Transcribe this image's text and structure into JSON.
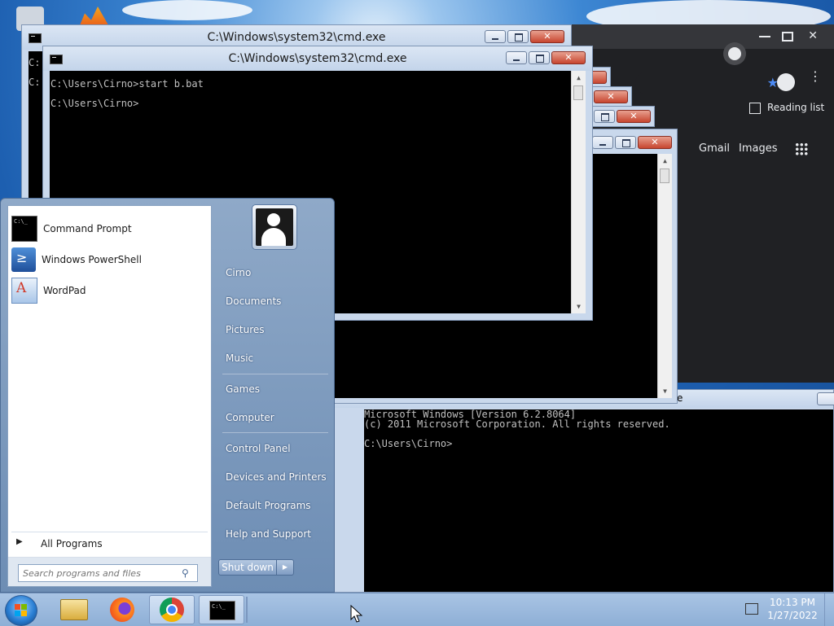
{
  "cmd_back": {
    "title": "C:\\Windows\\system32\\cmd.exe",
    "lines": [
      "C:",
      "C:"
    ]
  },
  "cmd_front": {
    "title": "C:\\Windows\\system32\\cmd.exe",
    "lines": [
      "C:\\Users\\Cirno>start b.bat",
      "C:\\Users\\Cirno>"
    ]
  },
  "cmd_bottom": {
    "lines": [
      "Microsoft Windows [Version 6.2.8064]",
      "(c) 2011 Microsoft Corporation. All rights reserved.",
      "",
      "C:\\Users\\Cirno>"
    ]
  },
  "chrome": {
    "reading_list": "Reading list",
    "gmail": "Gmail",
    "images": "Images"
  },
  "start_menu": {
    "programs": [
      {
        "label": "Command Prompt",
        "icon": "cmd-icon"
      },
      {
        "label": "Windows PowerShell",
        "icon": "powershell-icon"
      },
      {
        "label": "WordPad",
        "icon": "wordpad-icon"
      }
    ],
    "all_programs": "All Programs",
    "search_placeholder": "Search programs and files",
    "user": "Cirno",
    "right_items": [
      "Documents",
      "Pictures",
      "Music",
      "Games",
      "Computer",
      "Control Panel",
      "Devices and Printers",
      "Default Programs",
      "Help and Support"
    ],
    "shutdown": "Shut down"
  },
  "taskbar": {
    "time": "10:13 PM",
    "date": "1/27/2022",
    "pinned": [
      "explorer-icon",
      "firefox-icon",
      "chrome-icon",
      "cmd-icon"
    ]
  },
  "colors": {
    "console_bg": "#000000",
    "console_fg": "#c0c0c0",
    "chrome_bg": "#202124"
  }
}
